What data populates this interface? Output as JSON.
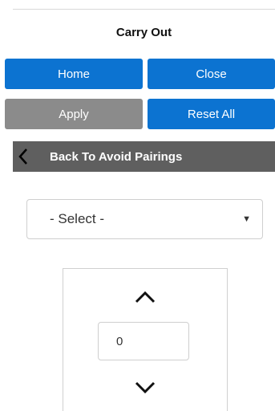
{
  "header": {
    "title": "Carry Out"
  },
  "buttons": {
    "home": "Home",
    "close": "Close",
    "apply": "Apply",
    "reset_all": "Reset All"
  },
  "nav": {
    "back_label": "Back To Avoid Pairings",
    "back_icon": "chevron-left-icon"
  },
  "select": {
    "value": "- Select -",
    "caret_icon": "caret-down-icon"
  },
  "stepper": {
    "value": "0",
    "up_icon": "chevron-up-icon",
    "down_icon": "chevron-down-icon"
  },
  "colors": {
    "primary": "#0c73d1",
    "disabled": "#8b8b8b",
    "back_bar": "#5f5f5f"
  }
}
